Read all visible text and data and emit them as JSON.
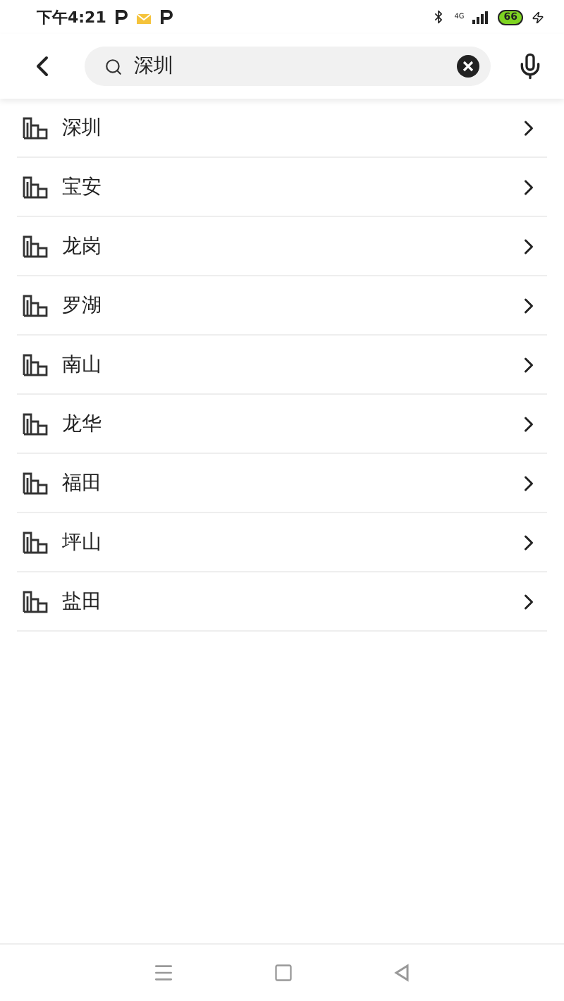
{
  "status_bar": {
    "time": "下午4:21",
    "network": "4G",
    "battery": "66"
  },
  "search": {
    "value": "深圳"
  },
  "results": [
    {
      "name": "深圳"
    },
    {
      "name": "宝安"
    },
    {
      "name": "龙岗"
    },
    {
      "name": "罗湖"
    },
    {
      "name": "南山"
    },
    {
      "name": "龙华"
    },
    {
      "name": "福田"
    },
    {
      "name": "坪山"
    },
    {
      "name": "盐田"
    }
  ]
}
